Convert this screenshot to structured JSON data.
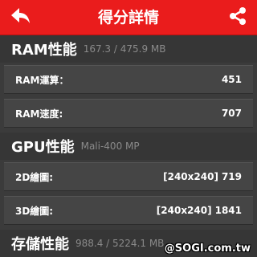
{
  "header": {
    "title": "得分詳情",
    "back_icon": "back-arrow-icon",
    "share_icon": "share-icon",
    "color": "#ea1c1c"
  },
  "sections": [
    {
      "title": "RAM性能",
      "subtitle": "167.3 / 475.9 MB",
      "rows": [
        {
          "label": "RAM運算：",
          "value": "451"
        },
        {
          "label": "RAM速度:",
          "value": "707"
        }
      ]
    },
    {
      "title": "GPU性能",
      "subtitle": "Mali-400 MP",
      "rows": [
        {
          "label": "2D繪圖:",
          "resolution": "[240x240]",
          "value": "719"
        },
        {
          "label": "3D繪圖:",
          "resolution": "[240x240]",
          "value": "1841"
        }
      ]
    },
    {
      "title": "存儲性能",
      "subtitle": "988.4 / 5224.1 MB"
    }
  ],
  "watermark": "@SOGI.com.tw"
}
